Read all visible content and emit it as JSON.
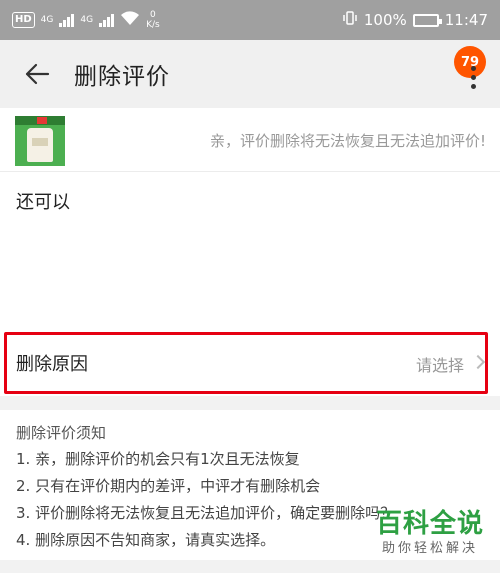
{
  "status_bar": {
    "hd_label": "HD",
    "signal1_label": "4G",
    "signal2_label": "4G",
    "speed_value": "0",
    "speed_unit": "K/s",
    "battery_text": "100%",
    "time": "11:47"
  },
  "header": {
    "title": "删除评价",
    "back_icon": "arrow-left-icon",
    "more_icon": "more-vertical-icon",
    "message_count": "79"
  },
  "product": {
    "notice": "亲，评价删除将无法恢复且无法追加评价!"
  },
  "review": {
    "text": "还可以"
  },
  "delete_reason": {
    "label": "删除原因",
    "placeholder": "请选择",
    "chevron_icon": "chevron-right-icon",
    "highlight_color": "#e60012"
  },
  "rules": {
    "title": "删除评价须知",
    "items": [
      "1. 亲，删除评价的机会只有1次且无法恢复",
      "2. 只有在评价期内的差评，中评才有删除机会",
      "3. 评价删除将无法恢复且无法追加评价，确定要删除吗？",
      "4. 删除原因不告知商家，请真实选择。"
    ]
  },
  "watermark": {
    "title": "百科全说",
    "subtitle": "助你轻松解决"
  }
}
